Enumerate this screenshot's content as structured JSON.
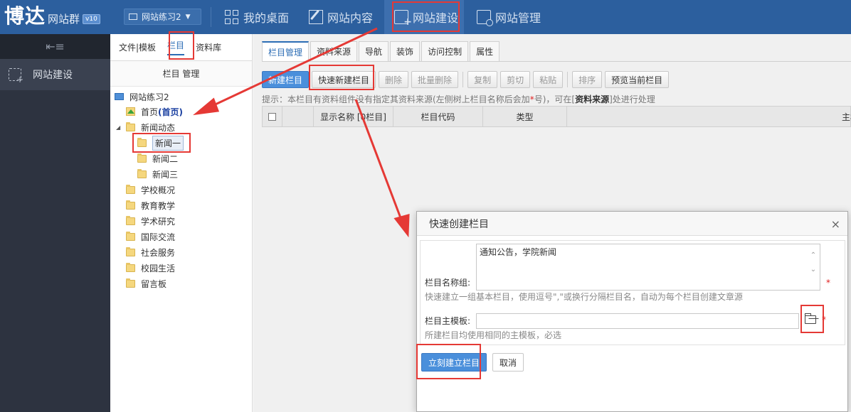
{
  "logo": {
    "main": "博达",
    "sub": "网站群",
    "version": "v10"
  },
  "site_select": {
    "value": "网站练习2"
  },
  "topnav": [
    {
      "label": "我的桌面",
      "icon": "desktop-grid-icon"
    },
    {
      "label": "网站内容",
      "icon": "edit-icon"
    },
    {
      "label": "网站建设",
      "icon": "site-build-icon"
    },
    {
      "label": "网站管理",
      "icon": "site-manage-icon"
    }
  ],
  "sidebar": {
    "toggle_icon": "menu-collapse-icon",
    "item": "网站建设"
  },
  "tree_panel": {
    "tabs": [
      "文件|模板",
      "栏目",
      "资料库"
    ],
    "header": "栏目 管理",
    "root": "网站练习2",
    "home": "首页",
    "home_suffix": "(首页)",
    "news": "新闻动态",
    "news_children": [
      "新闻一",
      "新闻二",
      "新闻三"
    ],
    "others": [
      "学校概况",
      "教育教学",
      "学术研究",
      "国际交流",
      "社会服务",
      "校园生活",
      "留言板"
    ]
  },
  "main": {
    "tabs": [
      "栏目管理",
      "资料来源",
      "导航",
      "装饰",
      "访问控制",
      "属性"
    ],
    "toolbar": {
      "new": "新建栏目",
      "quick_new": "快速新建栏目",
      "delete": "删除",
      "batch_delete": "批量删除",
      "copy": "复制",
      "cut": "剪切",
      "paste": "粘贴",
      "sort": "排序",
      "preview": "预览当前栏目"
    },
    "hint": {
      "part1": "提示：本栏目有资料组件没有指定其资料来源(左侧树上栏目名称后会加",
      "star": "*",
      "part2": "号)，可在[",
      "bold": "资料来源",
      "part3": "]处进行处理"
    },
    "grid_headers": [
      "显示名称 [0栏目]",
      "栏目代码",
      "类型",
      "主机"
    ]
  },
  "dialog": {
    "title": "快速创建栏目",
    "close": "×",
    "names_label": "栏目名称组:",
    "names_value": "通知公告，学院新闻",
    "names_note": "快速建立一组基本栏目，使用逗号\",\"或换行分隔栏目名，自动为每个栏目创建文章源",
    "template_label": "栏目主模板:",
    "template_value": "",
    "template_note": "所建栏目均使用相同的主模板，必选",
    "required_mark": "*",
    "submit": "立刻建立栏目",
    "cancel": "取消"
  },
  "colors": {
    "topbar": "#2c5f9e",
    "sidebar": "#2d3340",
    "accent": "#4a8fdb",
    "annotation": "#e53935"
  }
}
